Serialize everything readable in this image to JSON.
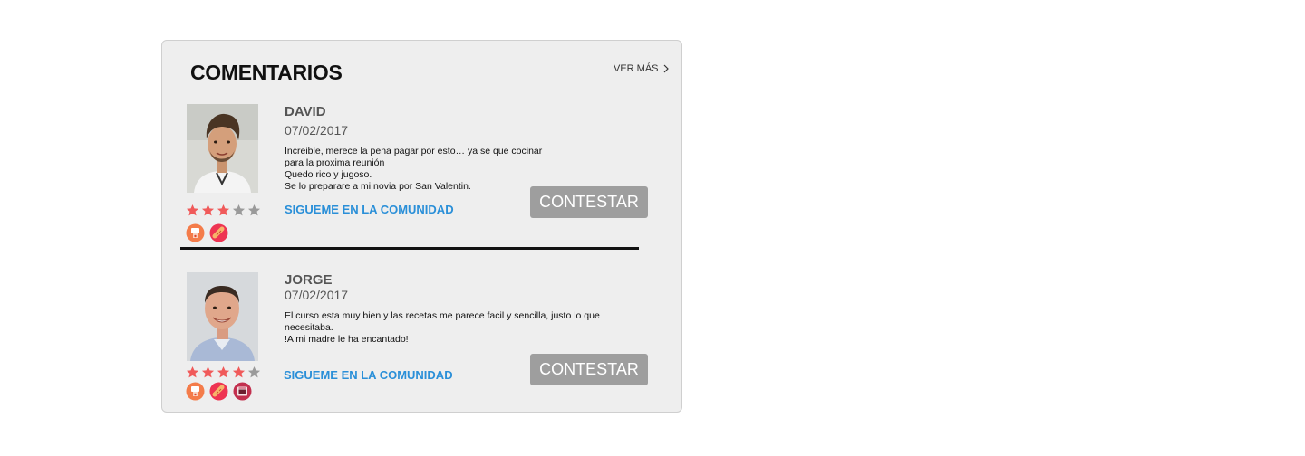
{
  "section": {
    "title": "COMENTARIOS",
    "see_more_label": "VER MÁS"
  },
  "comments": [
    {
      "name": "DAVID",
      "date": "07/02/2017",
      "text_lines": [
        "Increible, merece la pena pagar por esto… ya se que cocinar",
        "para la proxima reunión",
        "Quedo rico y jugoso.",
        "Se lo preparare a mi novia por San Valentin."
      ],
      "rating": 3,
      "rating_max": 5,
      "badges": [
        "blender-badge-icon",
        "sausage-badge-icon"
      ],
      "community_link": "SIGUEME EN LA COMUNIDAD",
      "reply_label": "CONTESTAR"
    },
    {
      "name": "JORGE",
      "date": "07/02/2017",
      "text_lines": [
        " El curso esta muy bien y las recetas me parece facil y sencilla, justo lo que",
        "necesitaba.",
        "!A mi madre le ha encantado!"
      ],
      "rating": 4,
      "rating_max": 5,
      "badges": [
        "blender-badge-icon",
        "sausage-badge-icon",
        "oven-badge-icon"
      ],
      "community_link": "SIGUEME EN LA COMUNIDAD",
      "reply_label": "CONTESTAR"
    }
  ],
  "colors": {
    "card_background": "#eeeeee",
    "star_filled": "#f05a5a",
    "star_empty": "#9a9a9a",
    "link": "#2a8fd8",
    "button": "#9e9e9e"
  }
}
